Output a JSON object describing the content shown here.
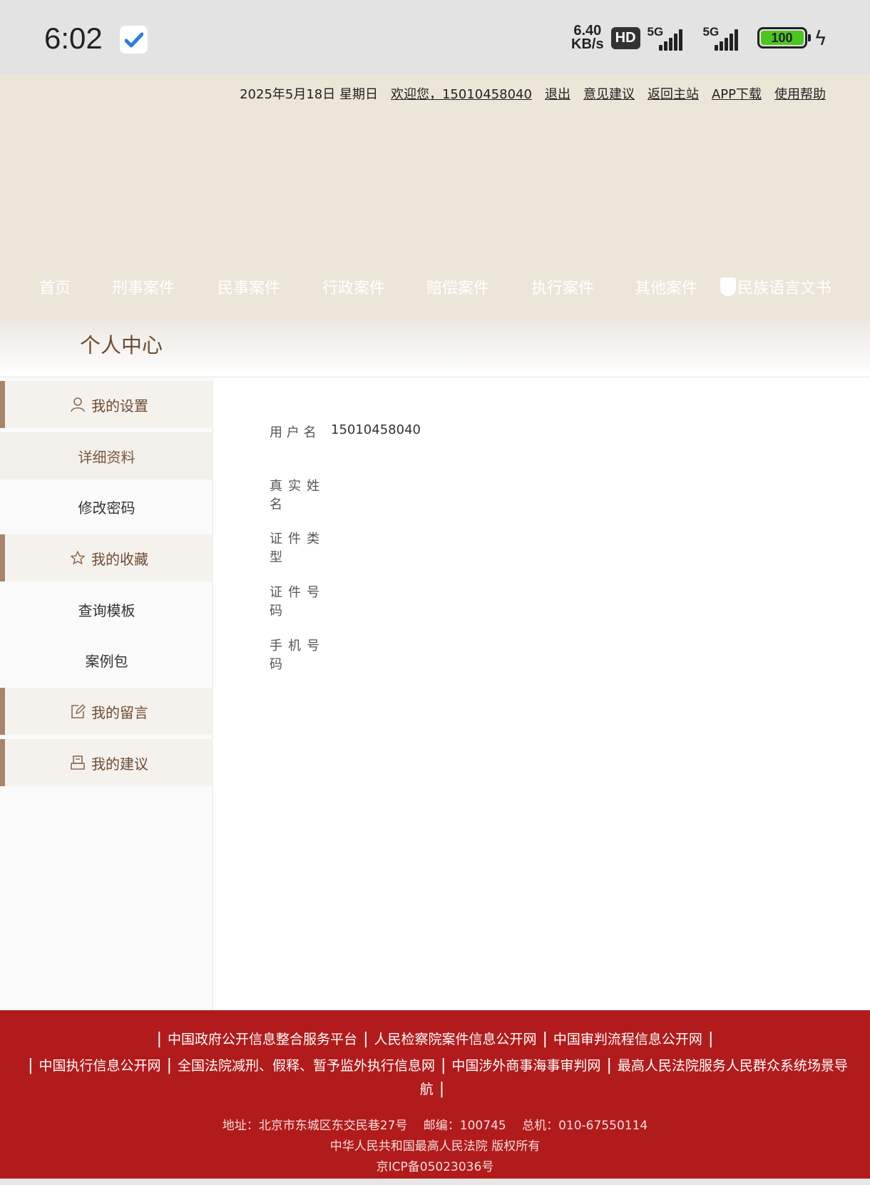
{
  "status_bar": {
    "time": "6:02",
    "speed_value": "6.40",
    "speed_unit": "KB/s",
    "hd_label": "HD",
    "signal1_label": "5G",
    "signal2_label": "5G",
    "battery": "100"
  },
  "top_links": {
    "date": "2025年5月18日 星期日",
    "welcome": "欢迎您，15010458040",
    "logout": "退出",
    "feedback": "意见建议",
    "home_site": "返回主站",
    "app_download": "APP下载",
    "help": "使用帮助"
  },
  "nav": {
    "home": "首页",
    "criminal": "刑事案件",
    "civil": "民事案件",
    "administrative": "行政案件",
    "compensation": "赔偿案件",
    "execution": "执行案件",
    "other": "其他案件",
    "ethnic": "民族语言文书"
  },
  "page_title": "个人中心",
  "sidebar": {
    "my_settings": "我的设置",
    "details": "详细资料",
    "change_password": "修改密码",
    "my_favorites": "我的收藏",
    "query_template": "查询模板",
    "case_package": "案例包",
    "my_messages": "我的留言",
    "my_suggestions": "我的建议"
  },
  "profile": {
    "username_label": "用 户 名",
    "username_value": "15010458040",
    "realname_label": "真实姓名",
    "idtype_label": "证件类型",
    "idnumber_label": "证件号码",
    "phone_label": "手机号码"
  },
  "footer": {
    "link1": "中国政府公开信息整合服务平台",
    "link2": "人民检察院案件信息公开网",
    "link3": "中国审判流程信息公开网",
    "link4": "中国执行信息公开网",
    "link5": "全国法院减刑、假释、暂予监外执行信息网",
    "link6": "中国涉外商事海事审判网",
    "link7a": "最高人民法院服务人民群众系统场景导",
    "link7b": "航",
    "address": "地址：北京市东城区东交民巷27号　 邮编：100745　 总机：010-67550114",
    "copyright": "中华人民共和国最高人民法院 版权所有",
    "icp": "京ICP备05023036号"
  }
}
